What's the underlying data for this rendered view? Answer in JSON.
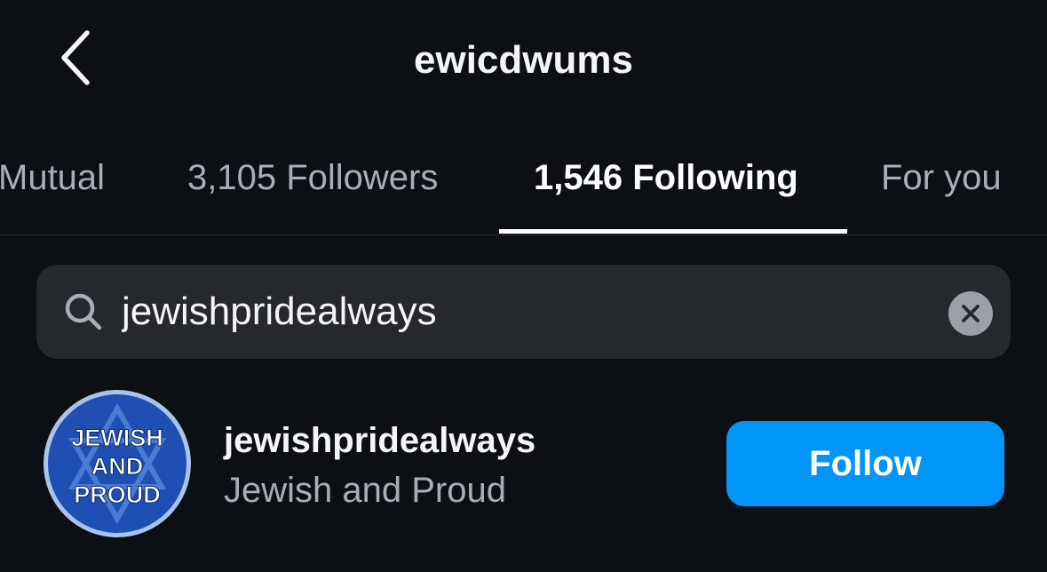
{
  "header": {
    "title": "ewicdwums",
    "back_icon": "chevron-left-icon"
  },
  "tabs": [
    {
      "label": "Mutual",
      "active": false
    },
    {
      "label": "3,105 Followers",
      "active": false
    },
    {
      "label": "1,546 Following",
      "active": true
    },
    {
      "label": "For you",
      "active": false
    }
  ],
  "search": {
    "icon": "search-icon",
    "value": "jewishpridealways",
    "clear_icon": "clear-icon"
  },
  "results": [
    {
      "username": "jewishpridealways",
      "full_name": "Jewish and Proud",
      "avatar_text": [
        "JEWISH",
        "AND",
        "PROUD"
      ],
      "follow_label": "Follow"
    }
  ],
  "colors": {
    "background": "#0c1014",
    "accent": "#0095f6",
    "secondary_text": "#a8aeb6",
    "search_bg": "#25292e"
  }
}
